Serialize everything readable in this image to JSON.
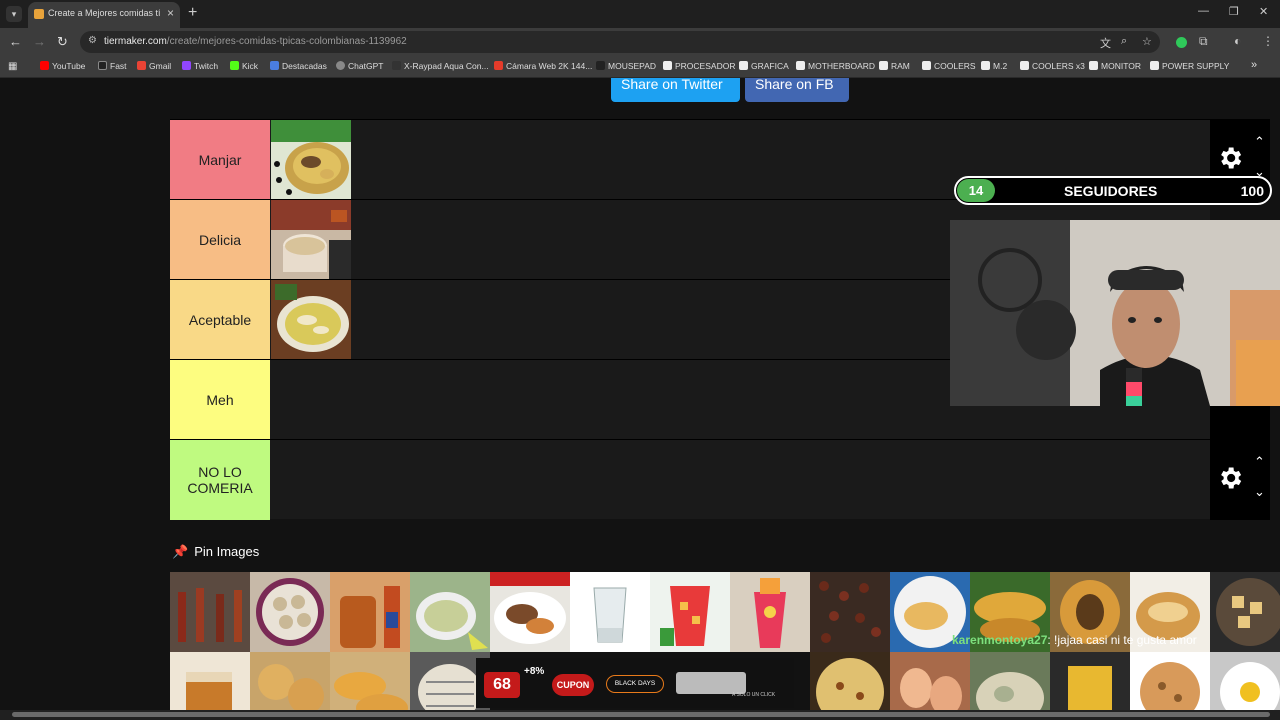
{
  "browser": {
    "tab_title": "Create a Mejores comidas típicas colombianas",
    "url_host": "tiermaker.com",
    "url_path": "/create/mejores-comidas-tpicas-colombianas-1139962",
    "bookmarks": [
      "YouTube",
      "Fast",
      "Gmail",
      "Twitch",
      "Kick",
      "Destacadas",
      "ChatGPT",
      "X-Raypad Aqua Con...",
      "Cámara Web 2K 144...",
      "MOUSEPAD",
      "PROCESADOR",
      "GRAFICA",
      "MOTHERBOARD",
      "RAM",
      "COOLERS",
      "M.2",
      "COOLERS x3",
      "MONITOR",
      "POWER SUPPLY"
    ]
  },
  "share": {
    "twitter": "Share on Twitter",
    "fb": "Share on FB"
  },
  "tiers": [
    {
      "label": "Manjar",
      "color": "#f17c84"
    },
    {
      "label": "Delicia",
      "color": "#f7bd85"
    },
    {
      "label": "Aceptable",
      "color": "#f9d987"
    },
    {
      "label": "Meh",
      "color": "#fdfd80"
    },
    {
      "label": "NO LO COMERIA",
      "color": "#bffa80"
    }
  ],
  "pin": {
    "title": "Pin Images"
  },
  "overlay": {
    "followers_current": "14",
    "followers_label": "SEGUIDORES",
    "followers_goal": "100",
    "chat_user": "karenmontoya27",
    "chat_message": ": !jajaa casi ni te gusta amor",
    "promo_value": "68",
    "promo_extra": "+8%",
    "promo_cupon": "CUPON",
    "promo_black_days": "BLACK DAYS",
    "promo_note": "A SOLO UN CLICK"
  },
  "colors": {
    "twitter_blue": "#1da1f2",
    "facebook_blue": "#4267b2",
    "follower_green": "#4caf50",
    "pin_red": "#e53e63"
  }
}
